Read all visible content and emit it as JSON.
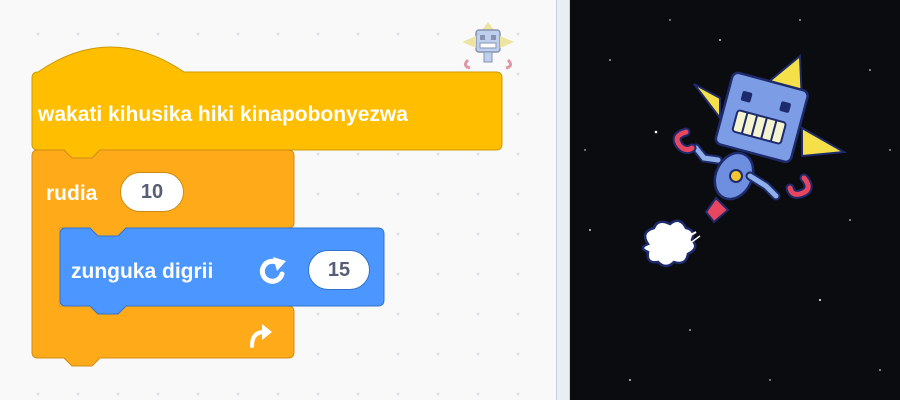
{
  "script": {
    "hat_block_label": "wakati kihusika hiki kinapobonyezwa",
    "repeat_block": {
      "label": "rudia",
      "value": "10"
    },
    "turn_block": {
      "label": "zunguka digrii",
      "value": "15",
      "icon": "rotate-clockwise-icon"
    },
    "loop_end_icon": "loop-arrow-icon"
  },
  "sprite_thumbnail": {
    "icon": "robot-sprite-icon"
  },
  "stage": {
    "sprite": "space-robot"
  },
  "colors": {
    "events": "#ffbf00",
    "control": "#ffab19",
    "motion": "#4c97ff",
    "stage_background": "#0b0c10"
  }
}
